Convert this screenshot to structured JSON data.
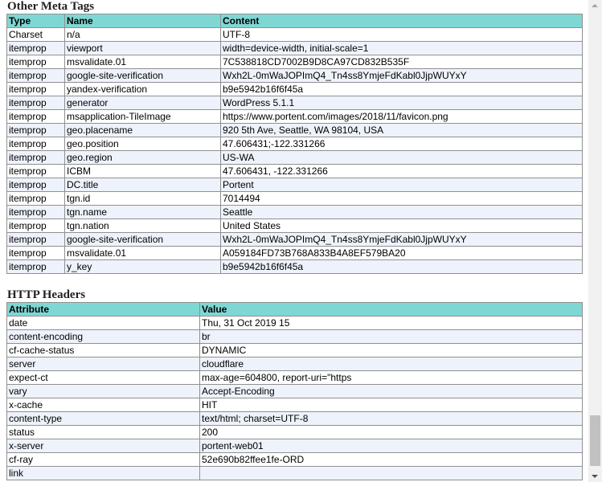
{
  "meta_section": {
    "title": "Other Meta Tags",
    "columns": [
      "Type",
      "Name",
      "Content"
    ],
    "rows": [
      [
        "Charset",
        "n/a",
        "UTF-8"
      ],
      [
        "itemprop",
        "viewport",
        "width=device-width, initial-scale=1"
      ],
      [
        "itemprop",
        "msvalidate.01",
        "7C538818CD7002B9D8CA97CD832B535F"
      ],
      [
        "itemprop",
        "google-site-verification",
        "Wxh2L-0mWaJOPImQ4_Tn4ss8YmjeFdKabl0JjpWUYxY"
      ],
      [
        "itemprop",
        "yandex-verification",
        "b9e5942b16f6f45a"
      ],
      [
        "itemprop",
        "generator",
        "WordPress 5.1.1"
      ],
      [
        "itemprop",
        "msapplication-TileImage",
        "https://www.portent.com/images/2018/11/favicon.png"
      ],
      [
        "itemprop",
        "geo.placename",
        "920 5th Ave, Seattle, WA 98104, USA"
      ],
      [
        "itemprop",
        "geo.position",
        "47.606431;-122.331266"
      ],
      [
        "itemprop",
        "geo.region",
        "US-WA"
      ],
      [
        "itemprop",
        "ICBM",
        "47.606431, -122.331266"
      ],
      [
        "itemprop",
        "DC.title",
        "Portent"
      ],
      [
        "itemprop",
        "tgn.id",
        "7014494"
      ],
      [
        "itemprop",
        "tgn.name",
        "Seattle"
      ],
      [
        "itemprop",
        "tgn.nation",
        "United States"
      ],
      [
        "itemprop",
        "google-site-verification",
        "Wxh2L-0mWaJOPImQ4_Tn4ss8YmjeFdKabl0JjpWUYxY"
      ],
      [
        "itemprop",
        "msvalidate.01",
        "A059184FD73B768A833B4A8EF579BA20"
      ],
      [
        "itemprop",
        "y_key",
        "b9e5942b16f6f45a"
      ]
    ]
  },
  "headers_section": {
    "title": "HTTP Headers",
    "columns": [
      "Attribute",
      "Value"
    ],
    "rows": [
      [
        "date",
        "Thu, 31 Oct 2019 15"
      ],
      [
        "content-encoding",
        "br"
      ],
      [
        "cf-cache-status",
        "DYNAMIC"
      ],
      [
        "server",
        "cloudflare"
      ],
      [
        "expect-ct",
        "max-age=604800, report-uri=\"https"
      ],
      [
        "vary",
        "Accept-Encoding"
      ],
      [
        "x-cache",
        "HIT"
      ],
      [
        "content-type",
        "text/html; charset=UTF-8"
      ],
      [
        "status",
        "200"
      ],
      [
        "x-server",
        "portent-web01"
      ],
      [
        "cf-ray",
        "52e690b82ffee1fe-ORD"
      ],
      [
        "link",
        ""
      ]
    ]
  },
  "colors": {
    "header_bg": "#7fd7d4",
    "row_alt_bg": "#eef3fb",
    "border": "#909090"
  }
}
